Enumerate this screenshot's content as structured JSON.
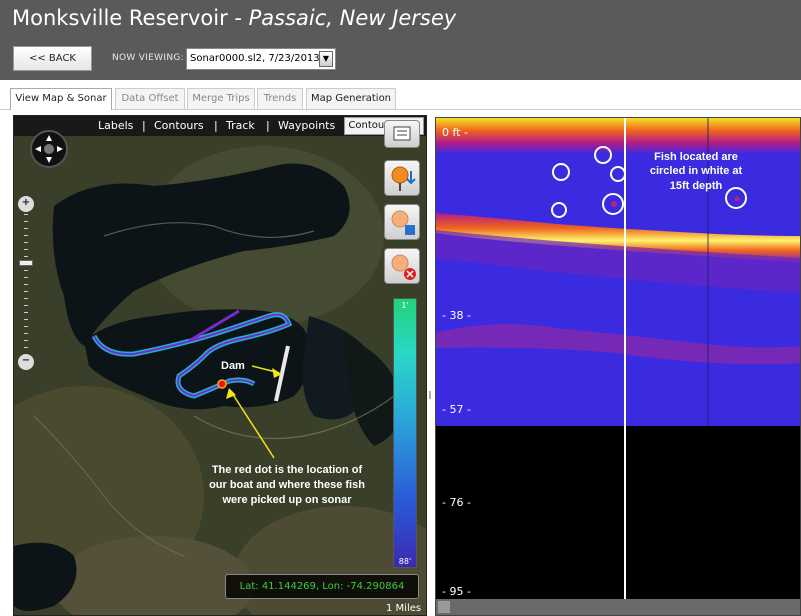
{
  "header": {
    "title_main": "Monksville Reservoir - ",
    "title_sub": "Passaic, New Jersey",
    "back_label": "<< BACK",
    "now_viewing_label": "NOW VIEWING:",
    "now_viewing_value": "Sonar0000.sl2, 7/23/2013"
  },
  "tabs": [
    {
      "label": "View Map & Sonar",
      "active": true
    },
    {
      "label": "Data Offset",
      "active": false
    },
    {
      "label": "Merge Trips",
      "active": false
    },
    {
      "label": "Trends",
      "active": false
    },
    {
      "label": "Map Generation",
      "active": false
    }
  ],
  "map": {
    "layers": [
      "Labels",
      "|",
      "Contours",
      "|",
      "Track",
      "|",
      "Waypoints"
    ],
    "contours_only": "Contours Only",
    "depth_scale_top": "1'",
    "depth_scale_bottom": "88'",
    "latlon": "Lat: 41.144269, Lon: -74.290864",
    "scale_label": "1 Miles",
    "dam_label": "Dam",
    "boat_note": "The red dot is the location of our boat and where these fish were picked up on sonar"
  },
  "sonar": {
    "depth_ticks": [
      "0 ft -",
      "- 38 -",
      "- 57 -",
      "- 76 -",
      "- 95 -"
    ],
    "fish_note": "Fish located are circled in white at 15ft depth"
  },
  "colors": {
    "header_bg": "#5a5a5a",
    "sonar_water": "#3b2be0",
    "sonar_bottom": "#f5d21e",
    "latlon_text": "#3ecb3e"
  },
  "icons": {
    "nav": "pan-compass-icon",
    "zoom_in": "zoom-in-icon",
    "zoom_out": "zoom-out-icon",
    "tool1": "edit-note-icon",
    "tool2": "add-waypoint-icon",
    "tool3": "save-waypoint-icon",
    "tool4": "delete-waypoint-icon"
  }
}
